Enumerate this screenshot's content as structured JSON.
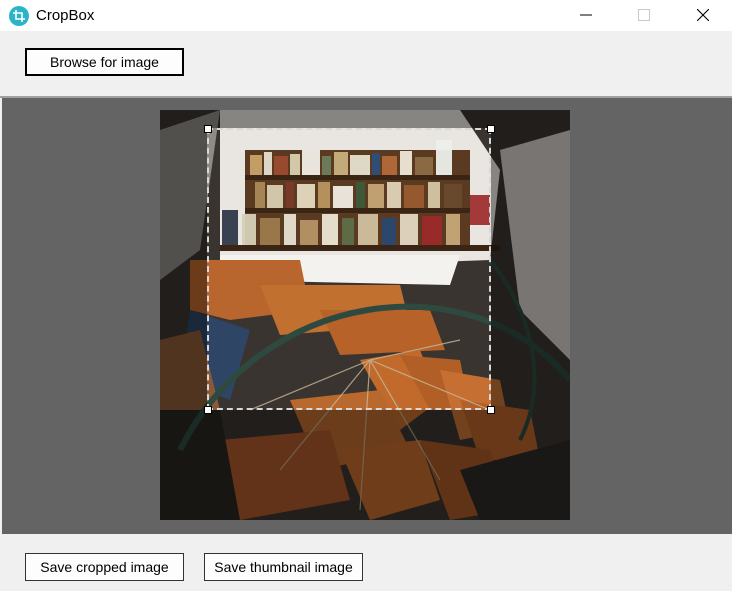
{
  "window": {
    "title": "CropBox",
    "icon": "crop-icon",
    "controls": [
      "minimize-icon",
      "maximize-icon",
      "close-icon"
    ]
  },
  "toolbar": {
    "browse_label": "Browse for image"
  },
  "footer": {
    "save_cropped_label": "Save cropped image",
    "save_thumbnail_label": "Save thumbnail image"
  },
  "colors": {
    "app_icon": "#2bb3c8",
    "canvas_bg": "#646464",
    "chrome_bg": "#f0f0f0"
  }
}
